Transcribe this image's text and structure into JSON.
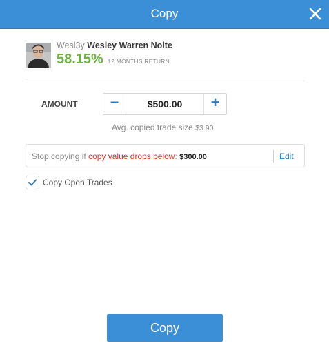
{
  "dialog": {
    "title": "Copy"
  },
  "trader": {
    "handle": "Wesl3y",
    "full_name": "Wesley Warren Nolte",
    "return_pct": "58.15%",
    "return_label": "12 MONTHS RETURN"
  },
  "amount": {
    "label": "AMOUNT",
    "value": "$500.00",
    "decrease_symbol": "−",
    "increase_symbol": "+",
    "avg_label": "Avg. copied trade size",
    "avg_value": "$3.90"
  },
  "stop_loss": {
    "prefix": "Stop copying if ",
    "condition": "copy value drops below",
    "separator": ": ",
    "value": "$300.00",
    "edit_label": "Edit"
  },
  "copy_open_trades": {
    "label": "Copy Open Trades",
    "checked": true
  },
  "primary_action": {
    "label": "Copy"
  },
  "colors": {
    "header": "#3b8fd6",
    "accent": "#2f7cc0",
    "return_green": "#6cb33e",
    "stop_red": "#d9312b"
  },
  "icons": {
    "close": "close-icon",
    "check": "checkmark-icon",
    "avatar": "user-photo"
  }
}
